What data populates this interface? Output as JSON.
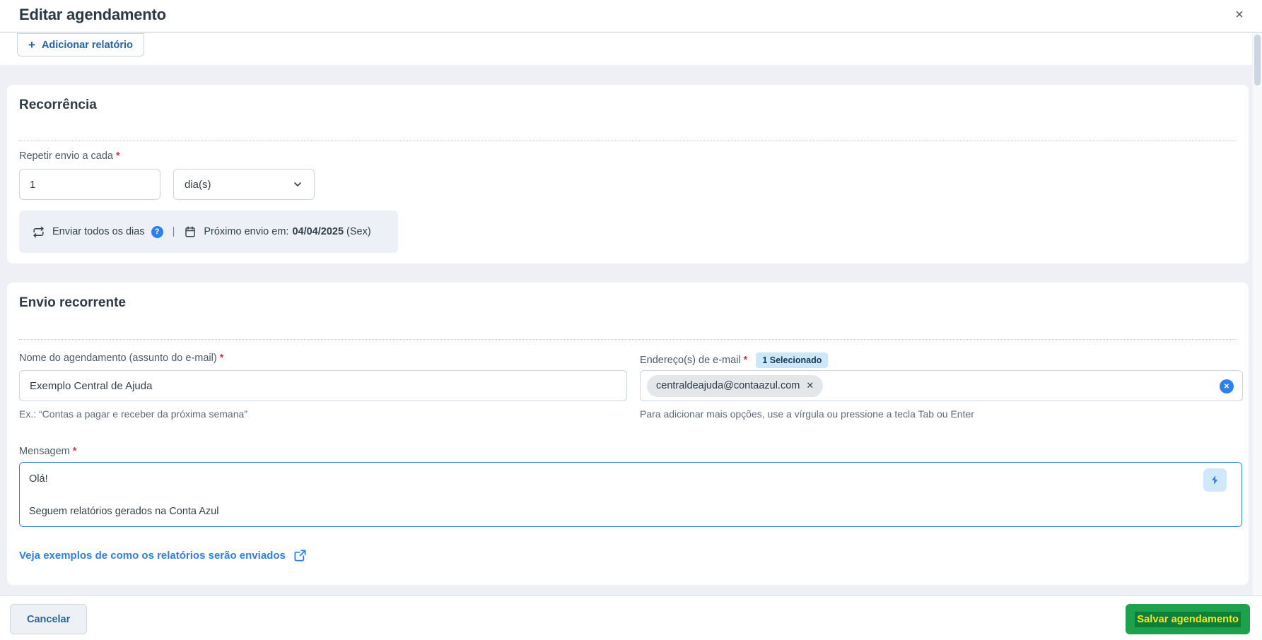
{
  "header": {
    "title": "Editar agendamento"
  },
  "icons": {
    "close": "×",
    "plus": "+",
    "question": "?",
    "pipe": "|",
    "chip_remove": "✕",
    "clear_all": "✕"
  },
  "reports": {
    "add_button_label": "Adicionar relatório"
  },
  "common": {
    "required_mark": "*"
  },
  "recurrence": {
    "title": "Recorrência",
    "repeat_label": "Repetir envio a cada",
    "interval_value": "1",
    "unit_value": "dia(s)",
    "summary": {
      "frequency_text": "Enviar todos os dias",
      "next_label": "Próximo envio em:",
      "next_date": "04/04/2025",
      "next_day": "(Sex)"
    }
  },
  "recurring": {
    "title": "Envio recorrente",
    "name": {
      "label": "Nome do agendamento (assunto do e-mail)",
      "value": "Exemplo Central de Ajuda",
      "helper": "Ex.: “Contas a pagar e receber da próxima semana”"
    },
    "emails": {
      "label": "Endereço(s) de e-mail",
      "badge": "1 Selecionado",
      "chip": "centraldeajuda@contaazul.com",
      "helper": "Para adicionar mais opções, use a vírgula ou pressione a tecla Tab ou Enter"
    },
    "message": {
      "label": "Mensagem",
      "value": "Olá!\n\nSeguem relatórios gerados na Conta Azul"
    },
    "examples_link_label": "Veja exemplos de como os relatórios serão enviados"
  },
  "footer": {
    "cancel_label": "Cancelar",
    "save_label": "Salvar agendamento"
  },
  "colors": {
    "accent_blue": "#2f80ed",
    "link_blue": "#2f7fe6",
    "button_text_blue": "#2a62ad",
    "save_green": "#1ea14c",
    "save_highlight_green": "#0c8038",
    "save_text_yellow": "#ffe600",
    "badge_bg": "#cbe7f8",
    "page_bg": "#eef0f5",
    "summary_bar_bg": "#edf1f7",
    "required_red": "#c43a55"
  }
}
